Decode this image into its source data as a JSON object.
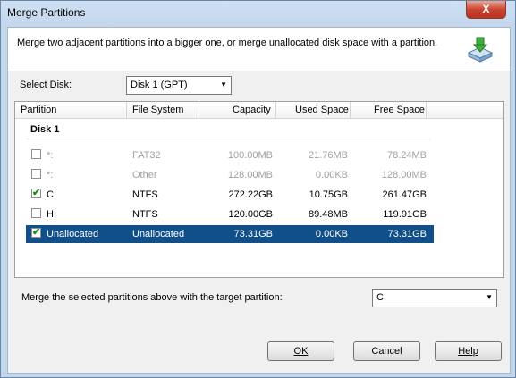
{
  "window": {
    "title": "Merge Partitions",
    "close_label": "X"
  },
  "header": {
    "description": "Merge two adjacent partitions into a bigger one, or merge unallocated disk space with a partition.",
    "icon": "merge-disk-icon"
  },
  "disk_select": {
    "label": "Select Disk:",
    "value": "Disk 1 (GPT)"
  },
  "table": {
    "columns": [
      "Partition",
      "File System",
      "Capacity",
      "Used Space",
      "Free Space"
    ],
    "group": "Disk 1",
    "rows": [
      {
        "checked": false,
        "partition": "*:",
        "fs": "FAT32",
        "capacity": "100.00MB",
        "used": "21.76MB",
        "free": "78.24MB",
        "state": "dim"
      },
      {
        "checked": false,
        "partition": "*:",
        "fs": "Other",
        "capacity": "128.00MB",
        "used": "0.00KB",
        "free": "128.00MB",
        "state": "dim"
      },
      {
        "checked": true,
        "partition": "C:",
        "fs": "NTFS",
        "capacity": "272.22GB",
        "used": "10.75GB",
        "free": "261.47GB",
        "state": "normal"
      },
      {
        "checked": false,
        "partition": "H:",
        "fs": "NTFS",
        "capacity": "120.00GB",
        "used": "89.48MB",
        "free": "119.91GB",
        "state": "normal"
      },
      {
        "checked": true,
        "partition": "Unallocated",
        "fs": "Unallocated",
        "capacity": "73.31GB",
        "used": "0.00KB",
        "free": "73.31GB",
        "state": "selected"
      }
    ]
  },
  "target": {
    "label": "Merge the selected partitions above with the target partition:",
    "value": "C:"
  },
  "buttons": {
    "ok": "OK",
    "cancel": "Cancel",
    "help": "Help"
  }
}
